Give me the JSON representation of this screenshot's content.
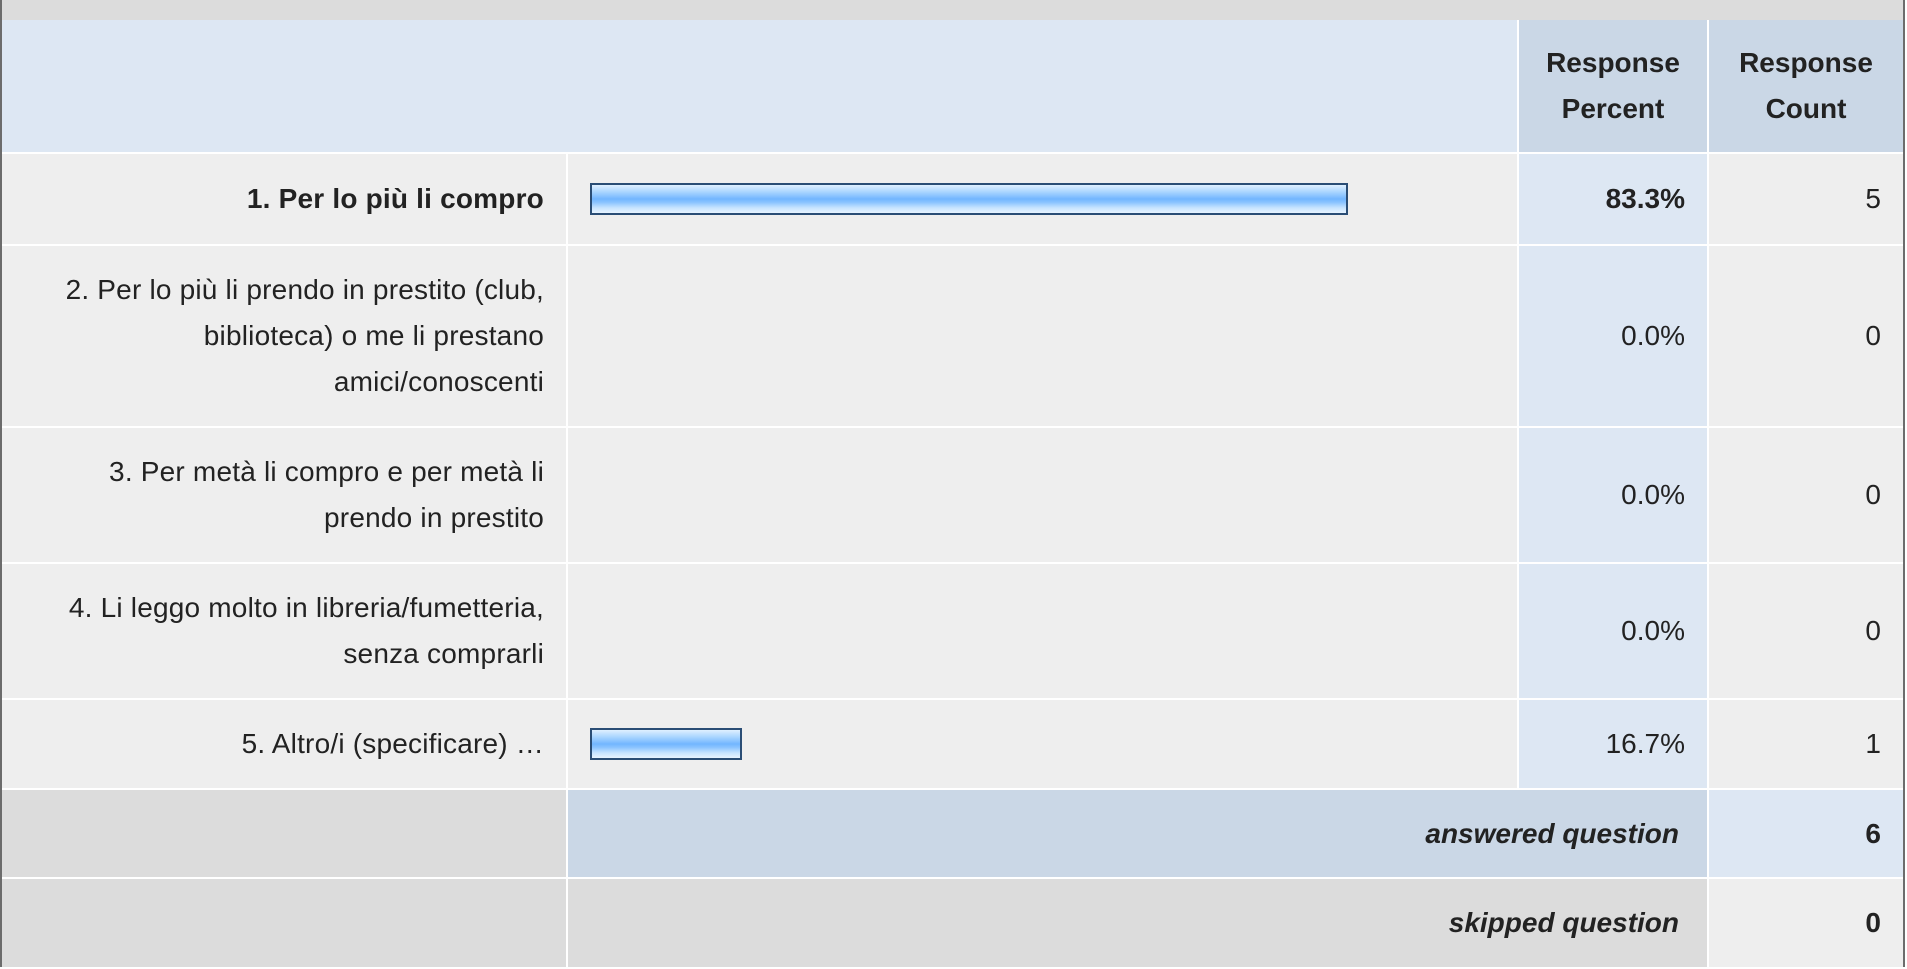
{
  "header": {
    "percent_label": "Response Percent",
    "count_label": "Response Count"
  },
  "rows": [
    {
      "label": "1. Per lo più li compro",
      "percent": "83.3%",
      "count": "5",
      "bar_fraction": 0.833,
      "bold": true
    },
    {
      "label": "2. Per lo più li prendo in prestito (club, biblioteca) o me li prestano amici/conoscenti",
      "percent": "0.0%",
      "count": "0",
      "bar_fraction": 0,
      "bold": false
    },
    {
      "label": "3. Per metà li compro e per metà li prendo in prestito",
      "percent": "0.0%",
      "count": "0",
      "bar_fraction": 0,
      "bold": false
    },
    {
      "label": "4. Li leggo molto in libreria/fumetteria, senza comprarli",
      "percent": "0.0%",
      "count": "0",
      "bar_fraction": 0,
      "bold": false
    },
    {
      "label": "5. Altro/i (specificare) …",
      "percent": "16.7%",
      "count": "1",
      "bar_fraction": 0.167,
      "bold": false
    }
  ],
  "footer": {
    "answered_label": "answered question",
    "answered_count": "6",
    "skipped_label": "skipped question",
    "skipped_count": "0"
  },
  "colors": {
    "bar_border": "#2a4d75",
    "bar_fill": "#72b6ff",
    "header_bg": "#dde7f3",
    "header_col_bg": "#cad7e6",
    "row_bg": "#eeeeee",
    "percent_col_bg": "#dde7f3"
  }
}
